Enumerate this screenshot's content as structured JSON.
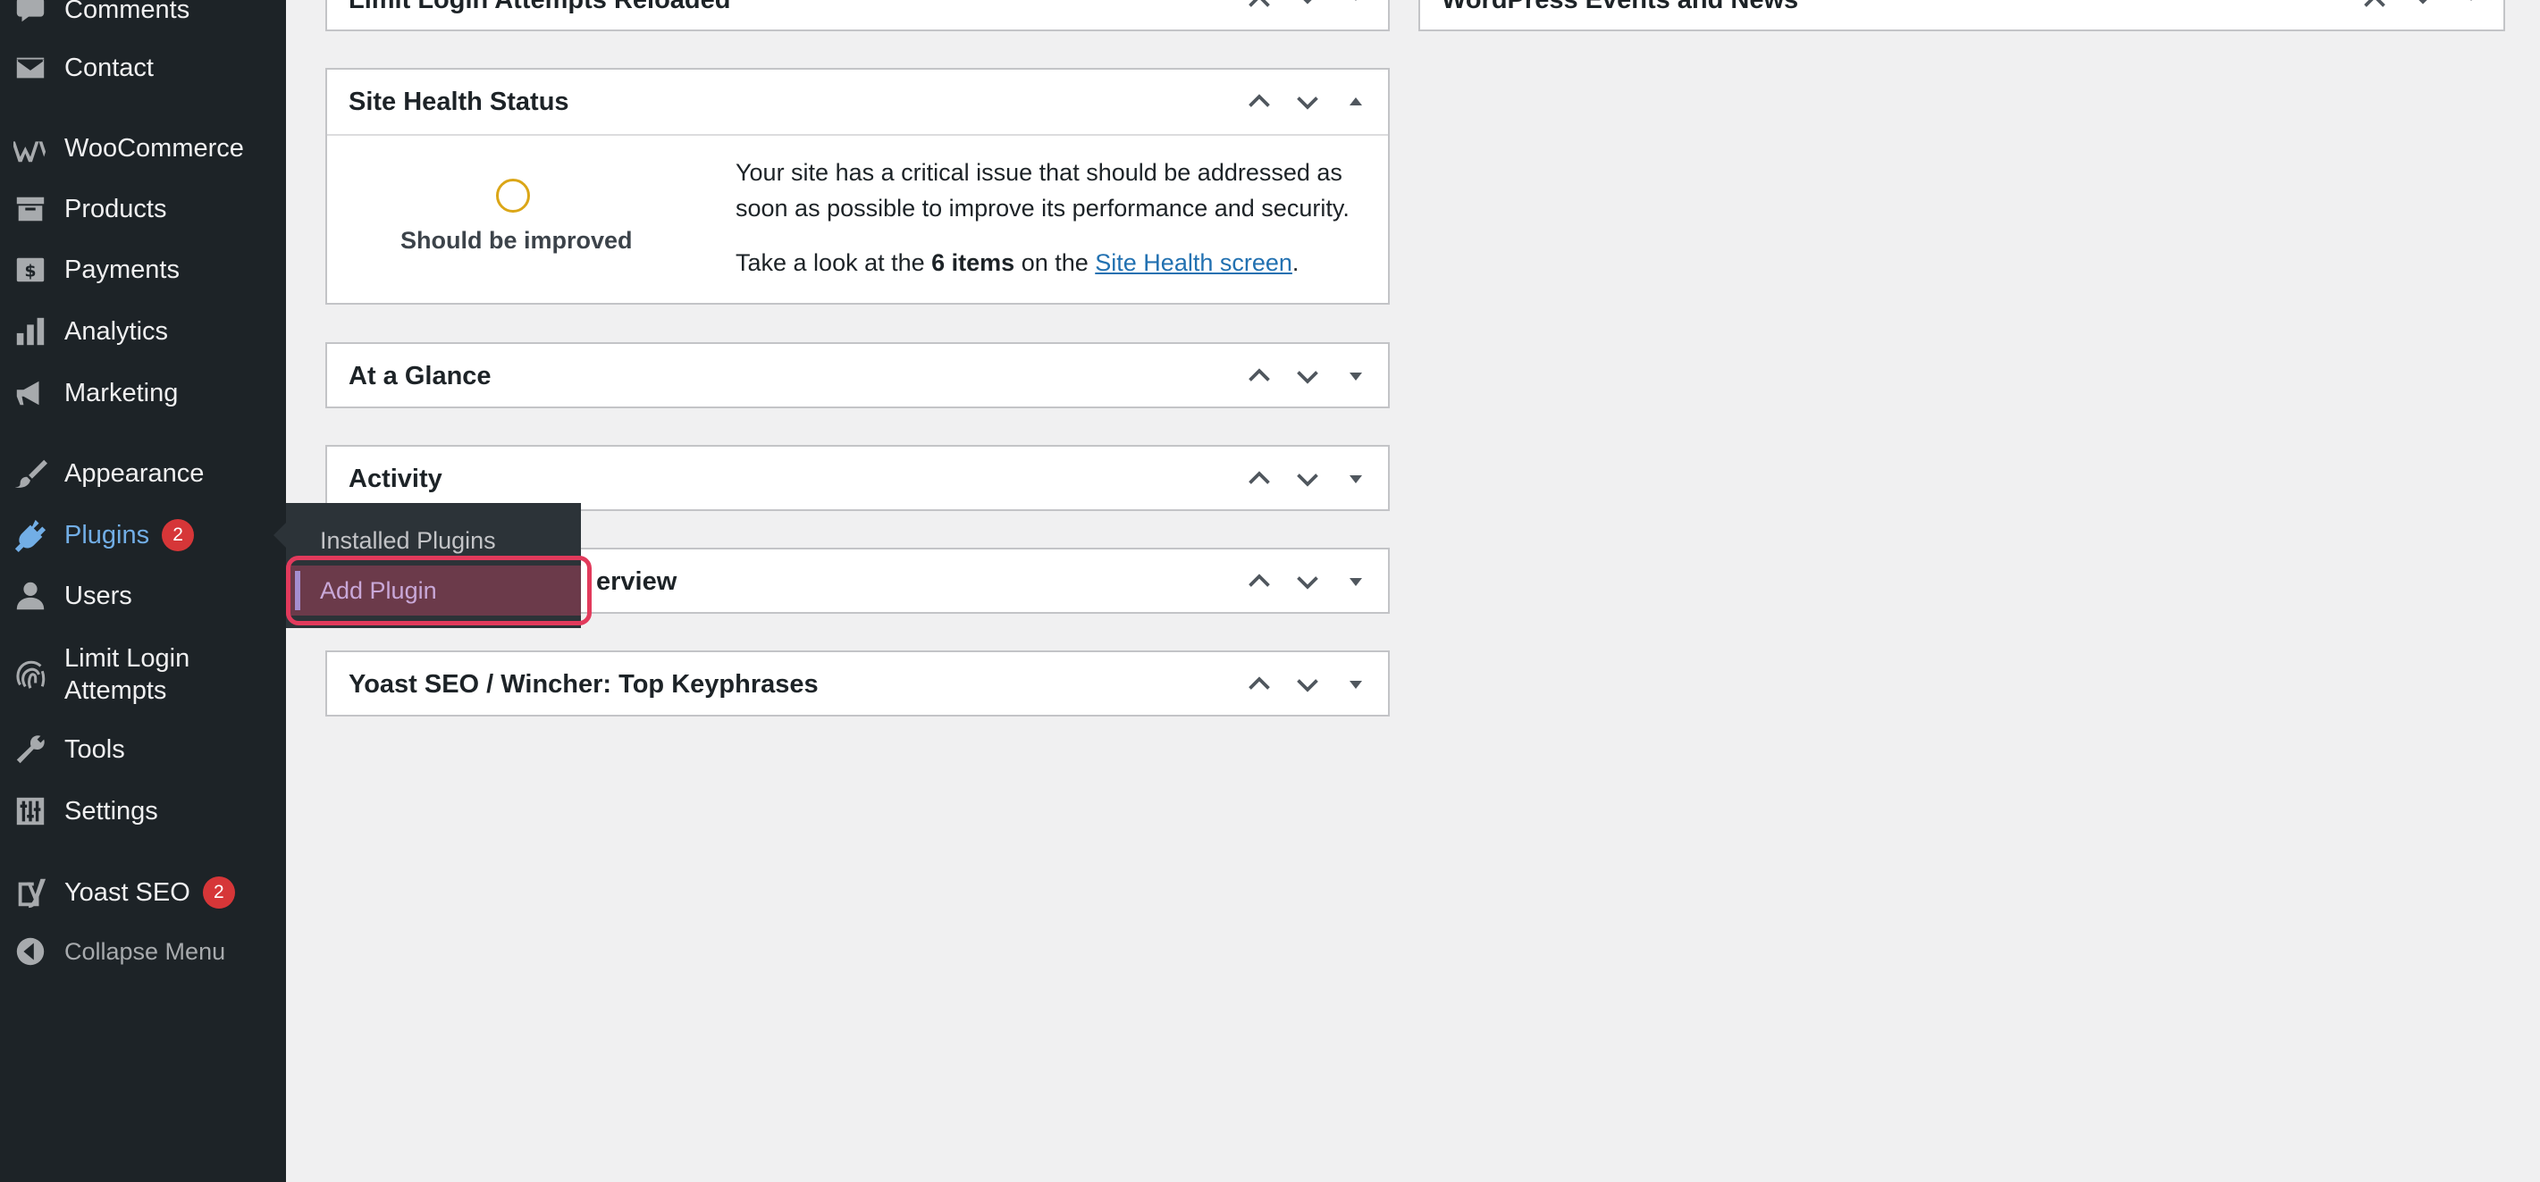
{
  "sidebar": {
    "items": [
      {
        "label": "Comments",
        "icon": "comment-icon"
      },
      {
        "label": "Contact",
        "icon": "mail-icon"
      },
      {
        "label": "WooCommerce",
        "icon": "woocommerce-icon"
      },
      {
        "label": "Products",
        "icon": "archive-icon"
      },
      {
        "label": "Payments",
        "icon": "dollar-icon"
      },
      {
        "label": "Analytics",
        "icon": "bar-chart-icon"
      },
      {
        "label": "Marketing",
        "icon": "megaphone-icon"
      },
      {
        "label": "Appearance",
        "icon": "paintbrush-icon"
      },
      {
        "label": "Plugins",
        "icon": "plug-icon",
        "badge": "2",
        "active": true
      },
      {
        "label": "Users",
        "icon": "user-icon"
      },
      {
        "label": "Limit Login",
        "label2": "Attempts",
        "icon": "fingerprint-icon"
      },
      {
        "label": "Tools",
        "icon": "wrench-icon"
      },
      {
        "label": "Settings",
        "icon": "sliders-icon"
      },
      {
        "label": "Yoast SEO",
        "icon": "yoast-icon",
        "badge": "2"
      },
      {
        "label": "Collapse Menu",
        "icon": "collapse-icon"
      }
    ],
    "flyout": {
      "items": [
        "Installed Plugins",
        "Add Plugin"
      ],
      "highlighted": "Add Plugin"
    }
  },
  "widgets": {
    "top_left": "Limit Login Attempts Reloaded",
    "top_right": "WordPress Events and News",
    "site_health": {
      "title": "Site Health Status",
      "status": "Should be improved",
      "message": "Your site has a critical issue that should be addressed as soon as possible to improve its performance and security.",
      "items_prefix": "Take a look at the ",
      "items_count": "6 items",
      "items_mid": " on the ",
      "items_link": "Site Health screen",
      "items_suffix": ".",
      "ring_color": "#dba617"
    },
    "at_a_glance": "At a Glance",
    "activity": "Activity",
    "overview_partial": "erview",
    "yoast": "Yoast SEO / Wincher: Top Keyphrases"
  },
  "colors": {
    "sidebar_bg": "#1d2327",
    "active": "#72aee6",
    "badge": "#d63638",
    "highlight_ring": "#e23a5c",
    "link": "#2271b1"
  }
}
